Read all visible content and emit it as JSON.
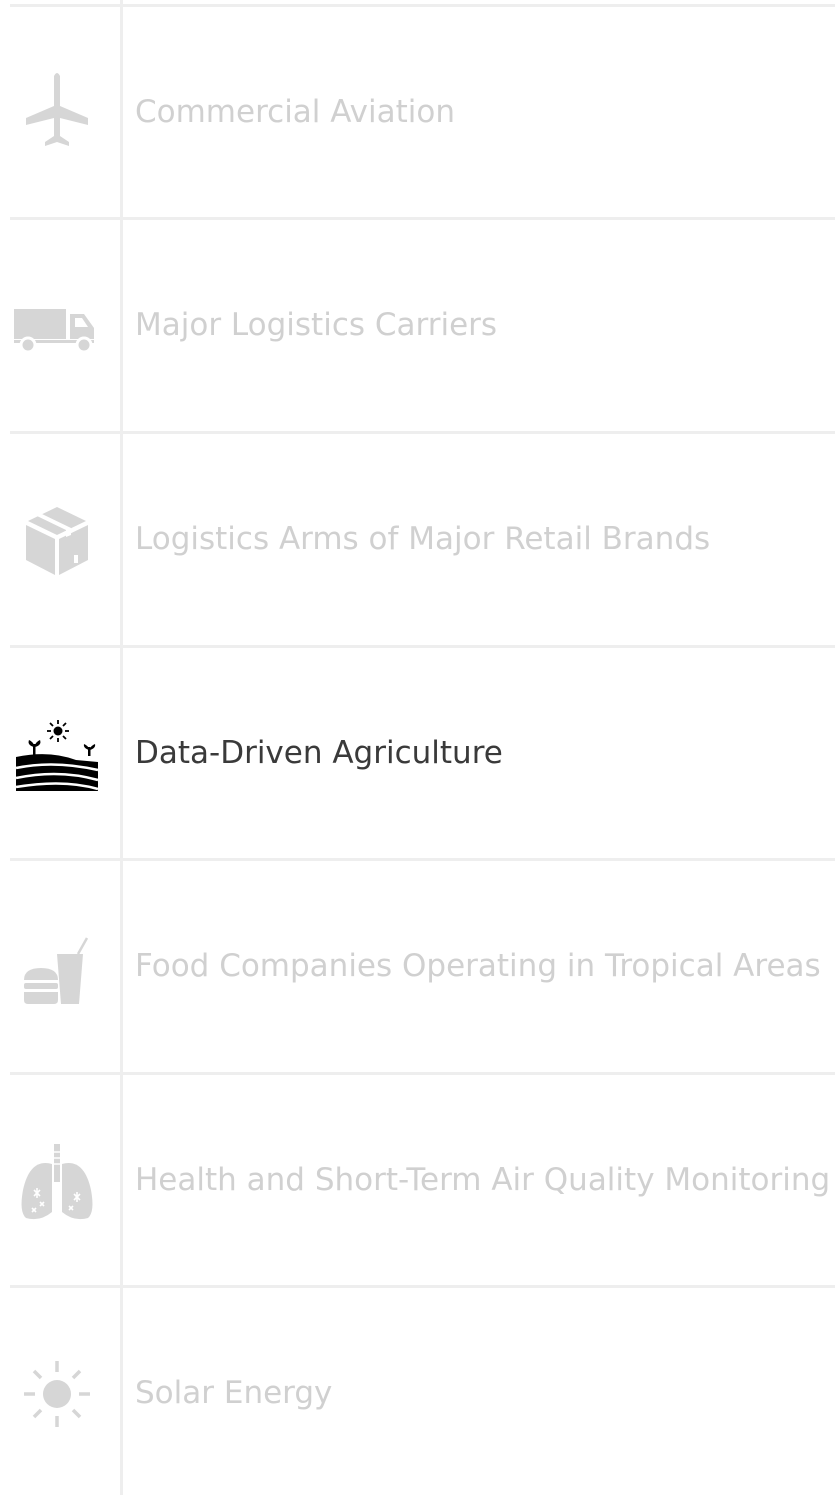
{
  "menu": {
    "items": [
      {
        "label": "Commercial Aviation",
        "icon": "airplane-icon",
        "active": false
      },
      {
        "label": "Major Logistics Carriers",
        "icon": "truck-icon",
        "active": false
      },
      {
        "label": "Logistics Arms of Major Retail Brands",
        "icon": "package-box-icon",
        "active": false
      },
      {
        "label": "Data-Driven Agriculture",
        "icon": "farm-field-icon",
        "active": true
      },
      {
        "label": "Food Companies Operating in Tropical Areas",
        "icon": "fast-food-icon",
        "active": false
      },
      {
        "label": "Health and Short-Term Air Quality Monitoring",
        "icon": "lungs-icon",
        "active": false
      },
      {
        "label": "Solar Energy",
        "icon": "sun-icon",
        "active": false
      }
    ]
  },
  "colors": {
    "inactive_text": "#d0d0d0",
    "inactive_icon": "#d6d6d6",
    "active_text": "#3a3a3a",
    "active_icon": "#000000",
    "divider": "#eeeeee"
  }
}
